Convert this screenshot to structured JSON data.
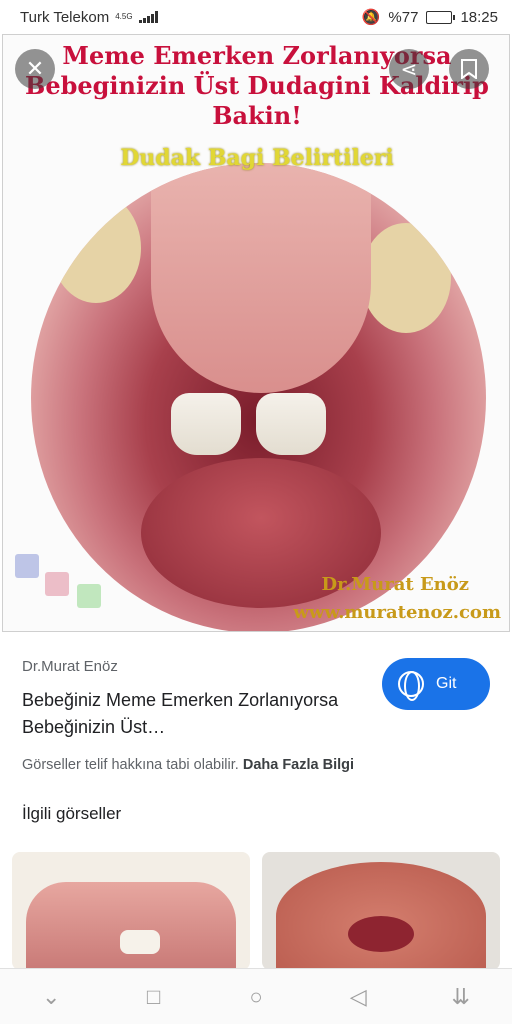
{
  "status_bar": {
    "carrier": "Turk Telekom",
    "network": "4.5G",
    "battery_text": "%77",
    "battery_level": 0.77,
    "time": "18:25"
  },
  "image": {
    "overlay_title": "Meme Emerken Zorlanıyorsa Bebeginizin Üst Dudagini Kaldirip Bakin!",
    "overlay_subtitle": "Dudak Bagi Belirtileri",
    "watermark_name": "Dr.Murat Enöz",
    "watermark_url": "www.muratenoz.com",
    "close_icon": "close-icon",
    "share_icon": "share-icon",
    "bookmark_icon": "bookmark-icon"
  },
  "result": {
    "source": "Dr.Murat Enöz",
    "title": "Bebeğiniz Meme Emerken Zorlanıyorsa Bebeğinizin Üst…",
    "visit_label": "Git",
    "copyright_text": "Görseller telif hakkına tabi olabilir.",
    "more_info_link": "Daha Fazla Bilgi"
  },
  "related": {
    "title": "İlgili görseller"
  },
  "colors": {
    "accent": "#1a73e8",
    "overlay_title": "#c8103c",
    "overlay_subtitle": "#e1d735",
    "watermark": "#c89a1a"
  }
}
